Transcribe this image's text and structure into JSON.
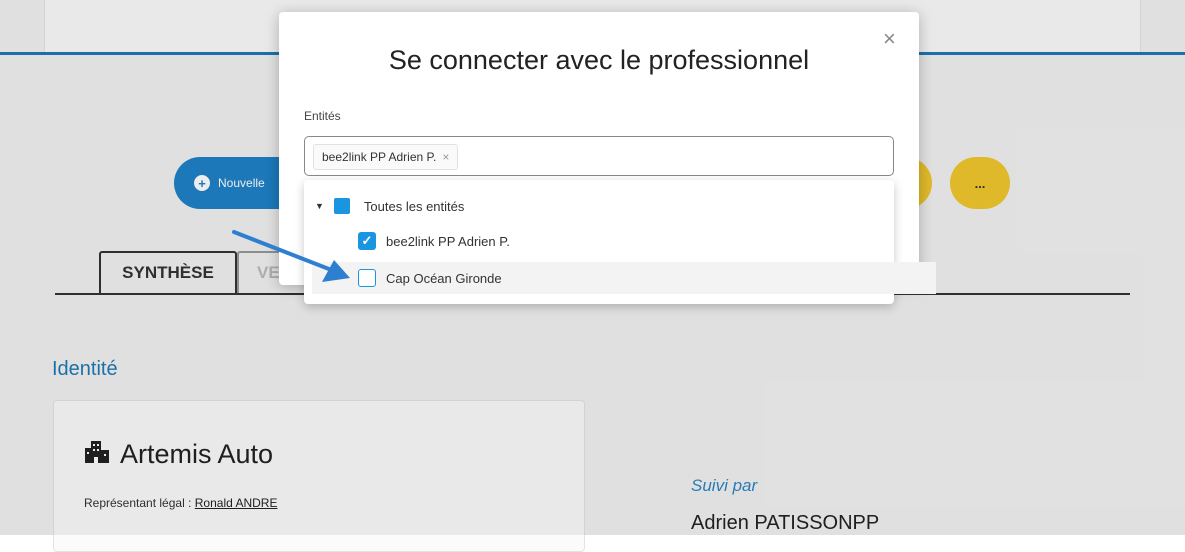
{
  "page": {
    "new_button_label": "Nouvelle",
    "more_button_label": "...",
    "tabs": [
      {
        "label": "SYNTHÈSE"
      },
      {
        "label": "VE"
      }
    ],
    "section_title": "Identité",
    "company_name": "Artemis Auto",
    "legal_rep_label": "Représentant légal :",
    "legal_rep_name": "Ronald ANDRE",
    "followed_by_label": "Suivi par",
    "followed_by_name": "Adrien PATISSONPP"
  },
  "modal": {
    "title": "Se connecter avec le professionnel",
    "close_symbol": "×",
    "field_label": "Entités",
    "selected_chip": "bee2link PP Adrien P.",
    "chip_remove_symbol": "×",
    "dropdown": {
      "parent_label": "Toutes les entités",
      "items": [
        {
          "label": "bee2link PP Adrien P.",
          "checked": true
        },
        {
          "label": "Cap Océan Gironde",
          "checked": false
        }
      ]
    }
  },
  "colors": {
    "accent_blue": "#1f79b5",
    "checkbox_blue": "#1a96e0",
    "primary_button": "#1f82c8",
    "secondary_button": "#f0c82e"
  },
  "icons": [
    "plus-circle-icon",
    "building-icon",
    "close-icon",
    "caret-down-icon",
    "check-icon",
    "arrow-annotation-icon"
  ]
}
